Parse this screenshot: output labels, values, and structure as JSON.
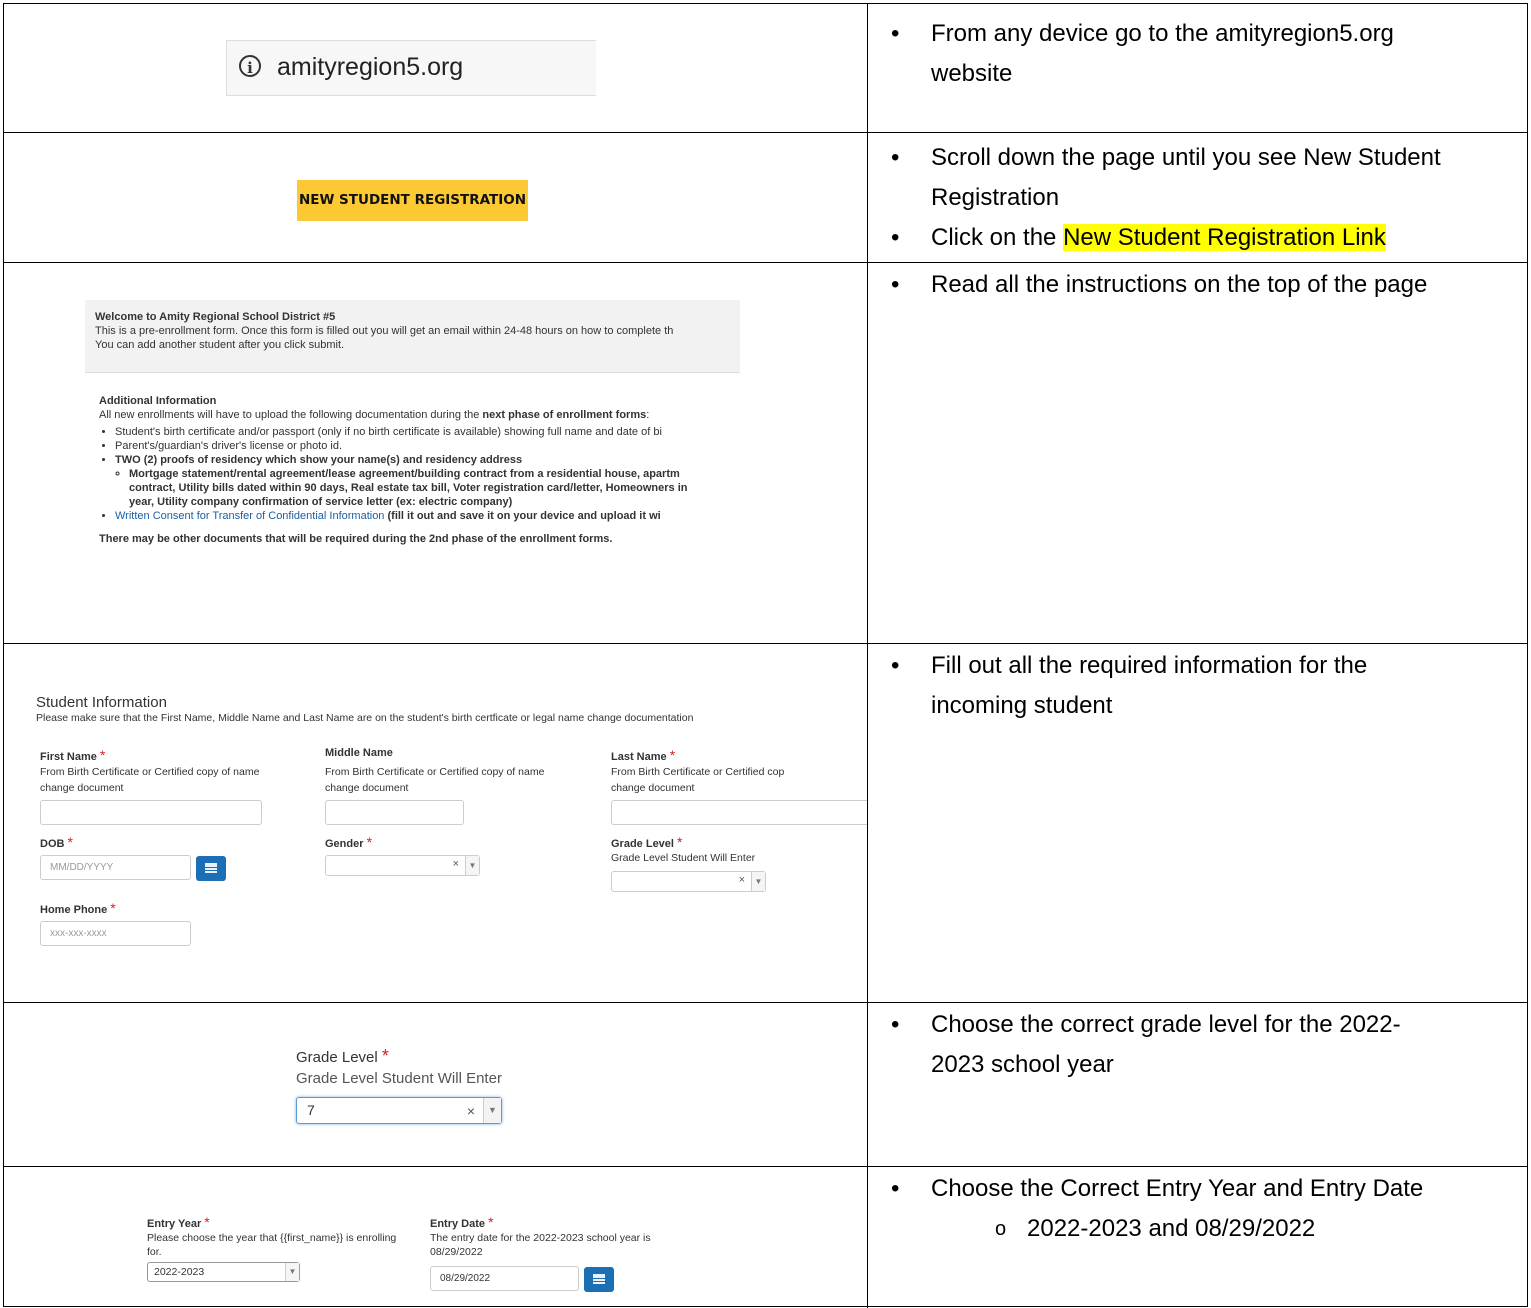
{
  "rows": [
    {
      "browser_url": "amityregion5.org",
      "bullets": [
        "From any device go to the amityregion5.org website"
      ]
    },
    {
      "button_label": "NEW STUDENT REGISTRATION",
      "bullets": [
        "Scroll down the page until you see New Student Registration"
      ],
      "bullet2_prefix": "Click on the ",
      "bullet2_highlight": "New Student Registration Link"
    },
    {
      "welcome_title": "Welcome to Amity Regional School District #5",
      "welcome_line1": "This is a pre-enrollment form. Once this form is filled out you will get an email within 24-48 hours on how to complete th",
      "welcome_line2": "You can add another student after you click submit.",
      "addl_title": "Additional Information",
      "addl_intro_prefix": "All new enrollments will have to upload the following documentation during the ",
      "addl_intro_bold": "next phase of enrollment forms",
      "addl_intro_suffix": ":",
      "addl_items": [
        "Student's birth certificate and/or passport (only if no birth certificate is available) showing full name and date of bi",
        "Parent's/guardian's driver's license or photo id.",
        "TWO (2) proofs of residency which show your name(s) and residency address"
      ],
      "addl_subitem": "Mortgage statement/rental agreement/lease agreement/building contract from a residential house, apartm contract, Utility bills dated within 90 days, Real estate tax bill, Voter registration card/letter, Homeowners in year, Utility company confirmation of service letter (ex: electric company)",
      "addl_subitem_lines": [
        "Mortgage statement/rental agreement/lease agreement/building contract from a residential house, apartm",
        "contract, Utility bills dated within 90 days, Real estate tax bill, Voter registration card/letter, Homeowners in",
        "year, Utility company confirmation of service letter (ex: electric company)"
      ],
      "consent_link": "Written Consent for Transfer of Confidential Information",
      "consent_suffix": " (fill it out and save it on your device and upload it wi",
      "addl_footer": "There may be other documents that will be required during the 2nd phase of the enrollment forms.",
      "bullets": [
        "Read all the instructions on the top of the page"
      ]
    },
    {
      "section_title": "Student Information",
      "section_note": "Please make sure that the First Name, Middle Name and Last Name are on the student's birth certficate or legal name change documentation",
      "first_name_label": "First Name",
      "middle_name_label": "Middle Name",
      "last_name_label": "Last Name",
      "name_hint": "From Birth Certificate or Certified copy of name change document",
      "name_hint_line1": "From Birth Certificate or Certified copy of name",
      "name_hint_line1_cut": "From Birth Certificate or Certified cop",
      "name_hint_line2": "change document",
      "dob_label": "DOB",
      "dob_placeholder": "MM/DD/YYYY",
      "gender_label": "Gender",
      "grade_label": "Grade Level",
      "grade_hint": "Grade Level Student Will Enter",
      "phone_label": "Home Phone",
      "phone_placeholder": "xxx-xxx-xxxx",
      "bullets": [
        "Fill out all the required information for the incoming student"
      ]
    },
    {
      "grade_label": "Grade Level",
      "grade_hint": "Grade Level Student Will Enter",
      "grade_value": "7",
      "bullets": [
        "Choose the correct grade level for the 2022-2023 school year"
      ]
    },
    {
      "entry_year_label": "Entry Year",
      "entry_year_hint_line1": "Please choose the year that {{first_name}} is enrolling",
      "entry_year_hint_line2": "for.",
      "entry_year_value": "2022-2023",
      "entry_date_label": "Entry Date",
      "entry_date_hint_line1": "The entry date for the 2022-2023 school year is",
      "entry_date_hint_line2": "08/29/2022",
      "entry_date_value": "08/29/2022",
      "bullets": [
        "Choose the Correct Entry Year and Entry Date"
      ],
      "subbullet": "2022-2023 and 08/29/2022"
    }
  ],
  "required_mark": "*",
  "clear_glyph": "×",
  "dropdown_glyph": "▼",
  "info_glyph": "i",
  "colors": {
    "highlight": "#ffff00",
    "button_bg": "#fcc935",
    "link": "#1a5fa8",
    "required": "#d92020",
    "calendar_btn": "#1c6eb5"
  }
}
